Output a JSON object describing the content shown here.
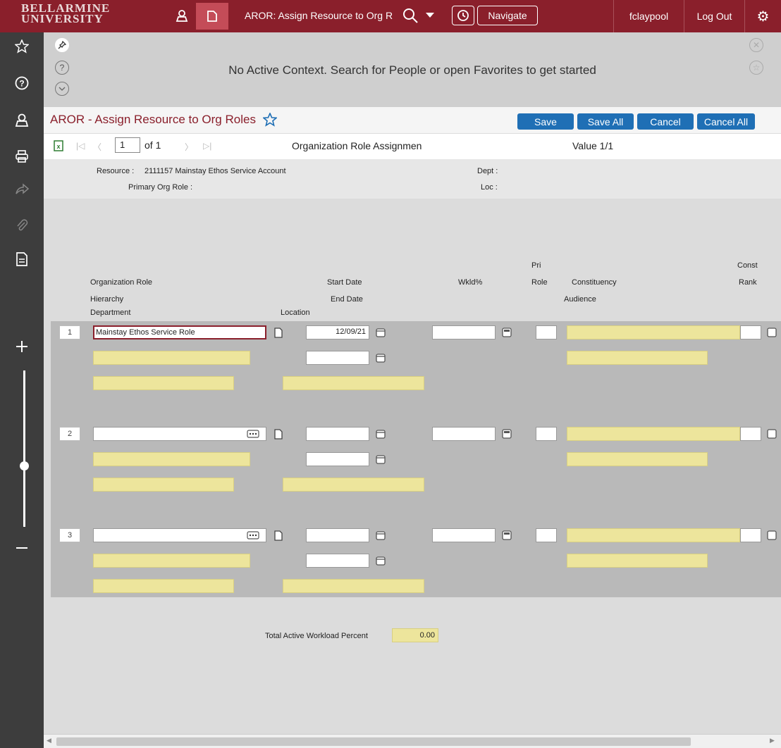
{
  "topbar": {
    "logo_line1": "BELLARMINE",
    "logo_line2": "UNIVERSITY",
    "form_title": "AROR: Assign Resource to Org R",
    "navigate_label": "Navigate",
    "username": "fclaypool",
    "logout_label": "Log Out",
    "brand_color": "#8a1f2b"
  },
  "context": {
    "message": "No Active Context. Search for People or open Favorites to get started"
  },
  "form": {
    "title": "AROR - Assign Resource to Org Roles",
    "buttons": {
      "save": "Save",
      "save_all": "Save All",
      "cancel": "Cancel",
      "cancel_all": "Cancel All"
    },
    "record_page": "1",
    "record_of": "of 1",
    "record_title": "Organization Role Assignmen",
    "record_value": "Value 1/1"
  },
  "header": {
    "resource_label": "Resource :",
    "resource_value": "2111157 Mainstay Ethos Service Account",
    "primary_org_role_label": "Primary Org Role :",
    "dept_label": "Dept :",
    "loc_label": "Loc :"
  },
  "columns": {
    "org_role": "Organization Role",
    "hierarchy": "Hierarchy",
    "department": "Department",
    "location": "Location",
    "start_date": "Start Date",
    "end_date": "End Date",
    "wkld": "Wkld%",
    "pri": "Pri",
    "role": "Role",
    "constituency": "Constituency",
    "audience": "Audience",
    "const": "Const",
    "rank": "Rank"
  },
  "rows": [
    {
      "num": "1",
      "org_role": "Mainstay Ethos Service Role",
      "start_date": "12/09/21"
    },
    {
      "num": "2",
      "org_role": "",
      "start_date": ""
    },
    {
      "num": "3",
      "org_role": "",
      "start_date": ""
    }
  ],
  "footer": {
    "total_label": "Total Active Workload Percent",
    "total_value": "0.00"
  }
}
